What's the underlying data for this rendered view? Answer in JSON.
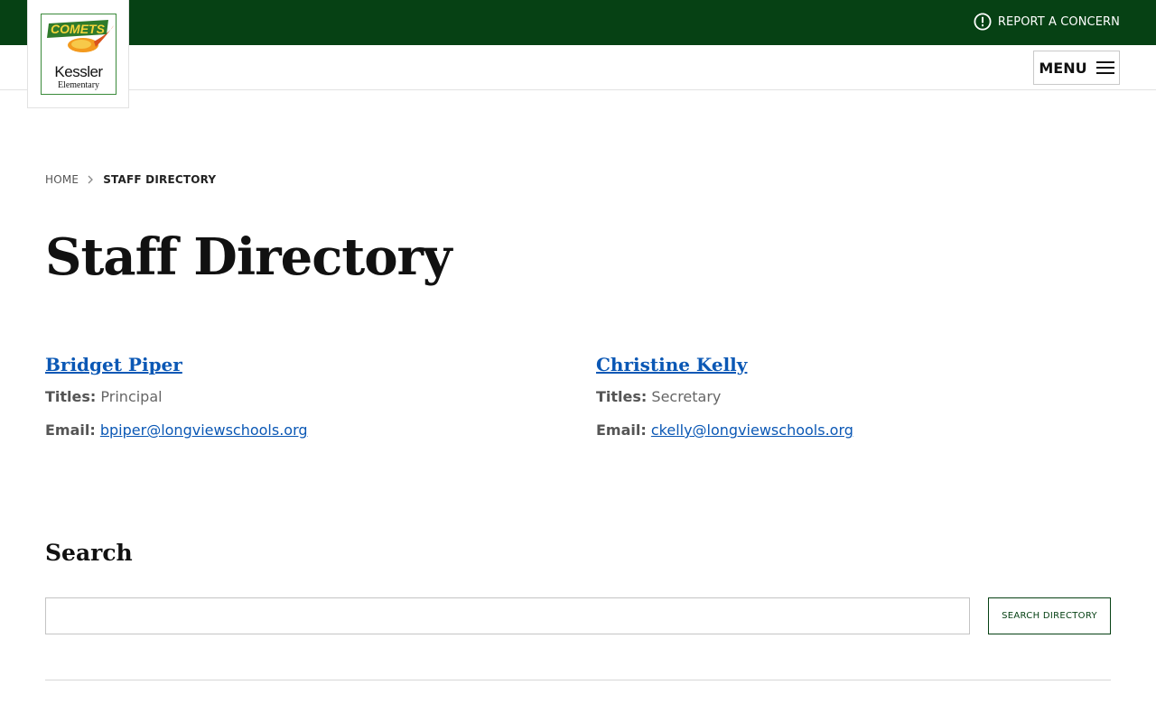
{
  "header": {
    "report_label": "REPORT A CONCERN",
    "menu_label": "MENU"
  },
  "logo": {
    "banner_text": "COMETS",
    "name": "Kessler",
    "subname": "Elementary"
  },
  "breadcrumb": {
    "home": "HOME",
    "current": "STAFF DIRECTORY"
  },
  "page": {
    "title": "Staff Directory"
  },
  "staff": [
    {
      "name": "Bridget Piper",
      "titles_label": "Titles:",
      "title": "Principal",
      "email_label": "Email:",
      "email": "bpiper@longviewschools.org"
    },
    {
      "name": "Christine Kelly",
      "titles_label": "Titles:",
      "title": "Secretary",
      "email_label": "Email:",
      "email": "ckelly@longviewschools.org"
    }
  ],
  "search": {
    "heading": "Search",
    "input_value": "",
    "button_label": "SEARCH DIRECTORY"
  },
  "colors": {
    "brand_green": "#064114",
    "link_blue": "#0b58b5"
  }
}
